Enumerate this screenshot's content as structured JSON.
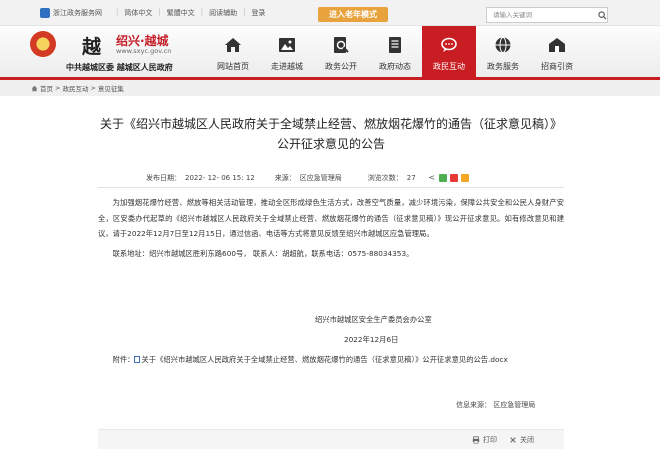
{
  "topbar": {
    "gov_portal": "浙江政务服务网",
    "links": [
      "简体中文",
      "繁體中文",
      "阅读辅助",
      "登录"
    ],
    "elder_mode": "进入老年模式",
    "search_placeholder": "请输入关键词"
  },
  "header": {
    "brand_char": "越",
    "brand_name": "绍兴·越城",
    "url": "www.sxyc.gov.cn",
    "org": "中共越城区委  越城区人民政府",
    "nav": [
      {
        "label": "网站首页",
        "icon": "home-icon"
      },
      {
        "label": "走进越城",
        "icon": "landscape-icon"
      },
      {
        "label": "政务公开",
        "icon": "document-search-icon"
      },
      {
        "label": "政府动态",
        "icon": "news-icon"
      },
      {
        "label": "政民互动",
        "icon": "chat-icon"
      },
      {
        "label": "政务服务",
        "icon": "globe-icon"
      },
      {
        "label": "招商引资",
        "icon": "building-icon"
      }
    ],
    "active_nav": "政民互动",
    "accent_color": "#c81e23"
  },
  "breadcrumb": {
    "items": [
      "首页",
      "政民互动",
      "意见征集"
    ],
    "separator": ">"
  },
  "article": {
    "title": "关于《绍兴市越城区人民政府关于全域禁止经营、燃放烟花爆竹的通告（征求意见稿）》公开征求意见的公告",
    "published_label": "发布日期：",
    "published": "2022- 12- 06 15: 12",
    "source_label": "来源：",
    "source": "区应急管理局",
    "views_label": "浏览次数：",
    "views": "27",
    "body": "为加强烟花爆竹经营、燃放等相关活动管理，推动全区形成绿色生活方式，改善空气质量，减少环境污染，保障公共安全和公民人身财产安全，区安委办代起草的《绍兴市越城区人民政府关于全域禁止经营、燃放烟花爆竹的通告（征求意见稿）》现公开征求意见。如有修改意见和建议，请于2022年12月7日至12月15日，通过信函、电话等方式将意见反馈至绍兴市越城区应急管理局。",
    "contact": "联系地址：绍兴市越城区胜利东路600号，  联系人：胡超航，联系电话：0575-88034353。",
    "sign_org": "绍兴市越城区安全生产委员会办公室",
    "sign_date": "2022年12月6日",
    "attachment_label": "附件：",
    "attachment": "关于《绍兴市越城区人民政府关于全域禁止经营、燃放烟花爆竹的通告（征求意见稿）》公开征求意见的公告.docx",
    "info_source": "信息来源：  区应急管理局"
  },
  "tools": {
    "print": "打印",
    "close": "关闭"
  }
}
